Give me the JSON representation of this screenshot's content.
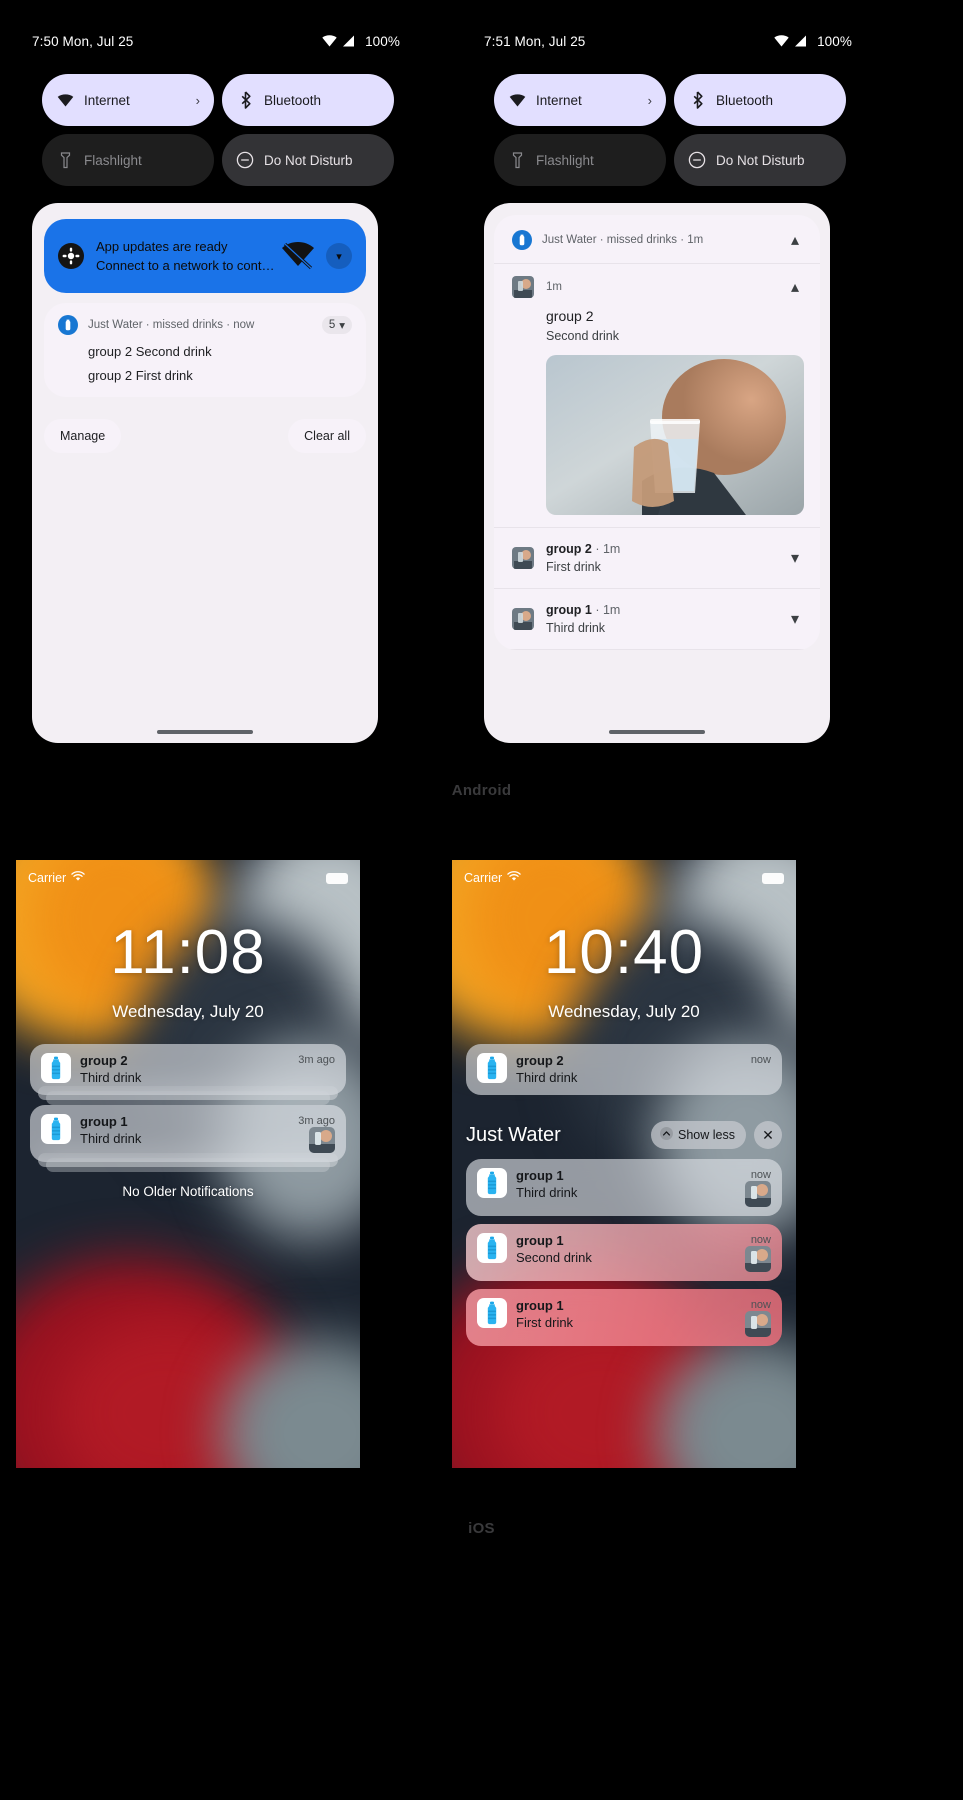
{
  "sections": {
    "android_caption": "Android",
    "ios_caption": "iOS"
  },
  "android": {
    "left": {
      "status": {
        "time": "7:50 Mon, Jul 25",
        "battery": "100%",
        "wifi_icon": "wifi-icon",
        "signal_icon": "signal-icon"
      },
      "tiles": [
        {
          "label": "Internet",
          "icon": "wifi-icon",
          "state": "on",
          "chevron": "›"
        },
        {
          "label": "Bluetooth",
          "icon": "bluetooth-icon",
          "state": "on"
        },
        {
          "label": "Flashlight",
          "icon": "flashlight-icon",
          "state": "off"
        },
        {
          "label": "Do Not Disturb",
          "icon": "do-not-disturb-icon",
          "state": "dnd"
        }
      ],
      "system_notification": {
        "title": "App updates are ready",
        "body": "Connect to a network to cont…",
        "icon": "settings-gear-icon",
        "trailing_icon": "wifi-off-icon",
        "expand_icon": "chevron-down-icon"
      },
      "app_notification": {
        "meta": "Just Water · missed drinks · now",
        "app_icon": "water-bottle-icon",
        "count": "5",
        "expand_icon": "chevron-down-icon",
        "lines": [
          "group 2 Second drink",
          "group 2 First drink"
        ]
      },
      "actions": {
        "manage": "Manage",
        "clear_all": "Clear all"
      }
    },
    "right": {
      "status": {
        "time": "7:51 Mon, Jul 25",
        "battery": "100%",
        "wifi_icon": "wifi-icon",
        "signal_icon": "signal-icon"
      },
      "tiles": [
        {
          "label": "Internet",
          "icon": "wifi-icon",
          "state": "on",
          "chevron": "›"
        },
        {
          "label": "Bluetooth",
          "icon": "bluetooth-icon",
          "state": "on"
        },
        {
          "label": "Flashlight",
          "icon": "flashlight-icon",
          "state": "off"
        },
        {
          "label": "Do Not Disturb",
          "icon": "do-not-disturb-icon",
          "state": "dnd"
        }
      ],
      "group_header": {
        "meta": "Just Water · missed drinks · 1m",
        "app_icon": "water-bottle-icon",
        "collapse_icon": "chevron-up-icon"
      },
      "expanded_item": {
        "time": "1m",
        "title": "group 2",
        "subtitle": "Second drink",
        "avatar": "person-drinking-water-avatar",
        "image": "glass-of-water-photo",
        "collapse_icon": "chevron-up-icon"
      },
      "rows": [
        {
          "title": "group 2",
          "time": "1m",
          "subtitle": "First drink",
          "avatar": "person-drinking-water-avatar",
          "expand_icon": "chevron-down-icon"
        },
        {
          "title": "group 1",
          "time": "1m",
          "subtitle": "Third drink",
          "avatar": "person-drinking-water-avatar",
          "expand_icon": "chevron-down-icon"
        }
      ]
    }
  },
  "ios": {
    "left": {
      "status": {
        "carrier": "Carrier",
        "wifi_icon": "wifi-icon",
        "battery_icon": "battery-full-icon"
      },
      "clock": "11:08",
      "date": "Wednesday, July 20",
      "notifications": [
        {
          "app_icon": "water-bottle-icon",
          "title": "group 2",
          "body": "Third drink",
          "time": "3m ago",
          "thumb": null,
          "stacked": true
        },
        {
          "app_icon": "water-bottle-icon",
          "title": "group 1",
          "body": "Third drink",
          "time": "3m ago",
          "thumb": "person-drinking-water-avatar",
          "stacked": true
        }
      ],
      "footer": "No Older Notifications"
    },
    "right": {
      "status": {
        "carrier": "Carrier",
        "wifi_icon": "wifi-icon",
        "battery_icon": "battery-full-icon"
      },
      "clock": "10:40",
      "date": "Wednesday, July 20",
      "top_notification": {
        "app_icon": "water-bottle-icon",
        "title": "group 2",
        "body": "Third drink",
        "time": "now",
        "thumb": null
      },
      "group": {
        "name": "Just Water",
        "show_less_label": "Show less",
        "show_less_icon": "chevron-up-icon",
        "close_icon": "close-icon",
        "notifications": [
          {
            "app_icon": "water-bottle-icon",
            "title": "group 1",
            "body": "Third drink",
            "time": "now",
            "thumb": "person-drinking-water-avatar",
            "tint": "none"
          },
          {
            "app_icon": "water-bottle-icon",
            "title": "group 1",
            "body": "Second drink",
            "time": "now",
            "thumb": "person-drinking-water-avatar",
            "tint": "pinkA"
          },
          {
            "app_icon": "water-bottle-icon",
            "title": "group 1",
            "body": "First drink",
            "time": "now",
            "thumb": "person-drinking-water-avatar",
            "tint": "pinkB"
          }
        ]
      }
    }
  },
  "colors": {
    "android_accent": "#1a73e8",
    "tile_on": "#e2dfff",
    "shade_bg": "#f3eff4",
    "caption": "#3a3a3c"
  }
}
